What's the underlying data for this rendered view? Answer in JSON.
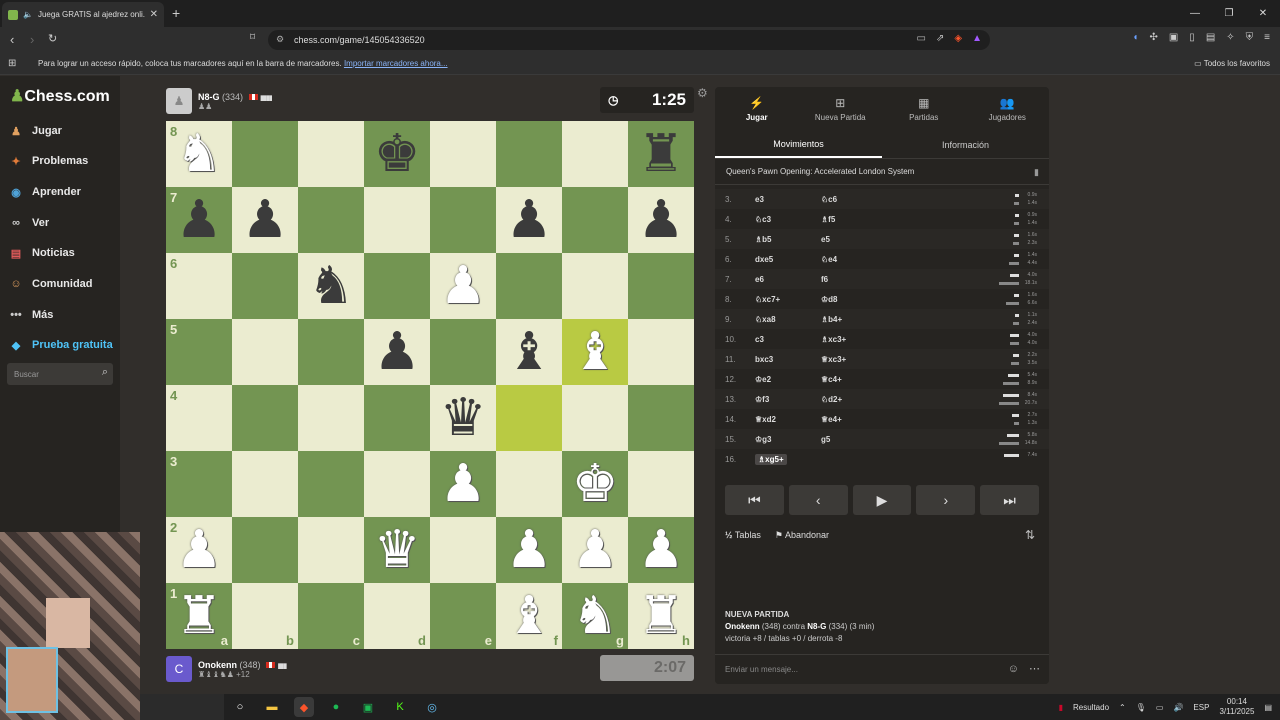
{
  "browser": {
    "tab_title": "Juega GRATIS al ajedrez onli...",
    "url": "chess.com/game/145054336520",
    "bookmarks_message": "Para lograr un acceso rápido, coloca tus marcadores aquí en la barra de marcadores.",
    "bookmarks_link": "Importar marcadores ahora...",
    "all_favorites": "Todos los favoritos"
  },
  "sidebar": {
    "logo": "Chess.com",
    "items": [
      {
        "label": "Jugar",
        "icon": "pawn-icon",
        "color": "#e0a060"
      },
      {
        "label": "Problemas",
        "icon": "puzzle-icon",
        "color": "#e07b39"
      },
      {
        "label": "Aprender",
        "icon": "lessons-icon",
        "color": "#4fa3d8"
      },
      {
        "label": "Ver",
        "icon": "binoculars-icon",
        "color": "#cccccc"
      },
      {
        "label": "Noticias",
        "icon": "news-icon",
        "color": "#e05a5a"
      },
      {
        "label": "Comunidad",
        "icon": "community-icon",
        "color": "#e0a060"
      },
      {
        "label": "Más",
        "icon": "more-icon",
        "color": "#cccccc"
      },
      {
        "label": "Prueba gratuita",
        "icon": "diamond-icon",
        "color": "#4fc3f7"
      }
    ],
    "search_placeholder": "Buscar"
  },
  "top_player": {
    "name": "N8-G",
    "rating": "(334)",
    "clock": "1:25"
  },
  "bottom_player": {
    "name": "Onokenn",
    "rating": "(348)",
    "captured": "+12",
    "clock": "2:07",
    "avatar_letter": "C"
  },
  "board": {
    "ranks": [
      "8",
      "7",
      "6",
      "5",
      "4",
      "3",
      "2",
      "1"
    ],
    "files": [
      "a",
      "b",
      "c",
      "d",
      "e",
      "f",
      "g",
      "h"
    ],
    "position": [
      [
        "wN",
        "",
        "",
        "bK",
        "",
        "",
        "",
        "bR"
      ],
      [
        "bP",
        "bP",
        "",
        "",
        "",
        "bP",
        "",
        "bP"
      ],
      [
        "",
        "",
        "bN",
        "",
        "wP",
        "",
        "",
        ""
      ],
      [
        "",
        "",
        "",
        "bP",
        "",
        "bB",
        "wB",
        ""
      ],
      [
        "",
        "",
        "",
        "",
        "bQ",
        "",
        "",
        ""
      ],
      [
        "",
        "",
        "",
        "",
        "wP",
        "",
        "wK",
        ""
      ],
      [
        "wP",
        "",
        "",
        "wQ",
        "",
        "wP",
        "wP",
        "wP"
      ],
      [
        "wR",
        "",
        "",
        "",
        "",
        "wB",
        "wN",
        "wR"
      ]
    ],
    "highlight": [
      "f4",
      "g5"
    ]
  },
  "panel": {
    "tabs": [
      {
        "label": "Jugar",
        "icon": "bolt-icon"
      },
      {
        "label": "Nueva Partida",
        "icon": "plus-icon"
      },
      {
        "label": "Partidas",
        "icon": "board-icon"
      },
      {
        "label": "Jugadores",
        "icon": "players-icon"
      }
    ],
    "move_tabs": [
      "Movimientos",
      "Información"
    ],
    "opening": "Queen's Pawn Opening: Accelerated London System",
    "moves": [
      {
        "n": "3.",
        "w": "e3",
        "b": "♘c6",
        "tw": "0.9s",
        "tb": "1.4s",
        "bw": 0.1,
        "bb": 0.15
      },
      {
        "n": "4.",
        "w": "♘c3",
        "b": "♗f5",
        "tw": "0.9s",
        "tb": "1.4s",
        "bw": 0.1,
        "bb": 0.15
      },
      {
        "n": "5.",
        "w": "♗b5",
        "b": "e5",
        "tw": "1.6s",
        "tb": "2.3s",
        "bw": 0.18,
        "bb": 0.25
      },
      {
        "n": "6.",
        "w": "dxe5",
        "b": "♘e4",
        "tw": "1.4s",
        "tb": "4.4s",
        "bw": 0.15,
        "bb": 0.45
      },
      {
        "n": "7.",
        "w": "e6",
        "b": "f6",
        "tw": "4.0s",
        "tb": "18.1s",
        "bw": 0.4,
        "bb": 1.0
      },
      {
        "n": "8.",
        "w": "♘xc7+",
        "b": "♔d8",
        "tw": "1.6s",
        "tb": "6.6s",
        "bw": 0.18,
        "bb": 0.6
      },
      {
        "n": "9.",
        "w": "♘xa8",
        "b": "♗b4+",
        "tw": "1.1s",
        "tb": "2.4s",
        "bw": 0.12,
        "bb": 0.25
      },
      {
        "n": "10.",
        "w": "c3",
        "b": "♗xc3+",
        "tw": "4.0s",
        "tb": "4.0s",
        "bw": 0.4,
        "bb": 0.4
      },
      {
        "n": "11.",
        "w": "bxc3",
        "b": "♕xc3+",
        "tw": "2.2s",
        "tb": "3.5s",
        "bw": 0.22,
        "bb": 0.35
      },
      {
        "n": "12.",
        "w": "♔e2",
        "b": "♕c4+",
        "tw": "5.4s",
        "tb": "8.9s",
        "bw": 0.5,
        "bb": 0.8
      },
      {
        "n": "13.",
        "w": "♔f3",
        "b": "♘d2+",
        "tw": "8.4s",
        "tb": "20.7s",
        "bw": 0.8,
        "bb": 1.0
      },
      {
        "n": "14.",
        "w": "♕xd2",
        "b": "♕e4+",
        "tw": "2.7s",
        "tb": "1.3s",
        "bw": 0.28,
        "bb": 0.14
      },
      {
        "n": "15.",
        "w": "♔g3",
        "b": "g5",
        "tw": "5.8s",
        "tb": "14.8s",
        "bw": 0.55,
        "bb": 1.0
      },
      {
        "n": "16.",
        "w": "♗xg5+",
        "b": "",
        "tw": "7.4s",
        "tb": "",
        "bw": 0.7,
        "bb": 0
      }
    ],
    "draw_label": "Tablas",
    "resign_label": "Abandonar",
    "new_game_title": "NUEVA PARTIDA",
    "new_game_line1_a": "Onokenn",
    "new_game_line1_b": " (348) contra ",
    "new_game_line1_c": "N8-G",
    "new_game_line1_d": " (334) (3 min)",
    "new_game_line2": "victoria +8 / tablas +0 / derrota -8",
    "chat_placeholder": "Enviar un mensaje..."
  },
  "taskbar": {
    "result_label": "Resultado",
    "lang": "ESP",
    "time": "00:14",
    "date": "3/11/2025"
  }
}
